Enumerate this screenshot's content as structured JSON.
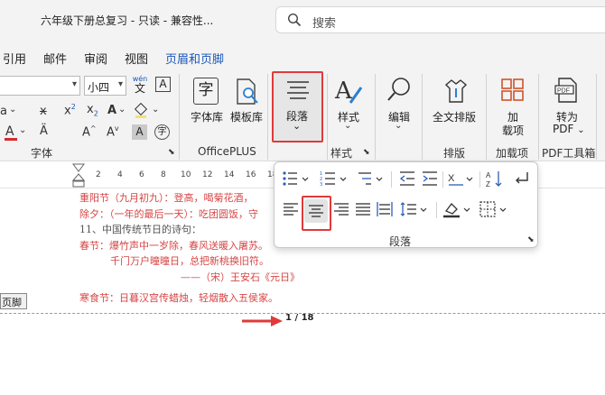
{
  "window": {
    "title": "六年级下册总复习 - 只读 - 兼容性...",
    "search_placeholder": "搜索"
  },
  "tabs": [
    "引用",
    "邮件",
    "审阅",
    "视图",
    "页眉和页脚"
  ],
  "active_tab": "页眉和页脚",
  "font_group": {
    "font_size": "小四",
    "phonetic_top": "wén",
    "phonetic_bottom": "文",
    "label": "字体"
  },
  "officeplus_group": {
    "font_lib_label": "字体库",
    "template_lib_label": "模板库",
    "label": "OfficePLUS"
  },
  "paragraph_button": {
    "label": "段落",
    "chevron": "⌄"
  },
  "style_group": {
    "button_label": "样式",
    "label": "样式"
  },
  "edit_button": {
    "label": "编辑"
  },
  "layout_group": {
    "button_label": "全文排版",
    "label": "排版"
  },
  "addins_group": {
    "button_line1": "加",
    "button_line2": "载项",
    "label": "加载项"
  },
  "pdf_group": {
    "button_line1": "转为",
    "button_line2": "PDF",
    "label": "PDF工具箱"
  },
  "ruler_numbers": [
    "2",
    "4",
    "6",
    "8",
    "10",
    "12",
    "14",
    "16",
    "18"
  ],
  "document": {
    "lines": [
      "重阳节（九月初九）：登高，喝菊花酒，",
      "除夕：（一年的最后一天）：吃团圆饭，守",
      "11、中国传统节日的诗句：",
      "春节：爆竹声中一岁除，春风送暖入屠苏。",
      "千门万户曈曈日，总把新桃换旧符。",
      "——（宋）王安石《元日》",
      "寒食节：日暮汉宫传蜡烛，轻烟散入五侯家。"
    ],
    "footer_tag": "页脚",
    "page_indicator": "1 / 18"
  },
  "paragraph_dropdown": {
    "label": "段落"
  },
  "colors": {
    "accent": "#1a56b8",
    "highlight": "#e03a3a",
    "doc_red": "#d64545"
  }
}
